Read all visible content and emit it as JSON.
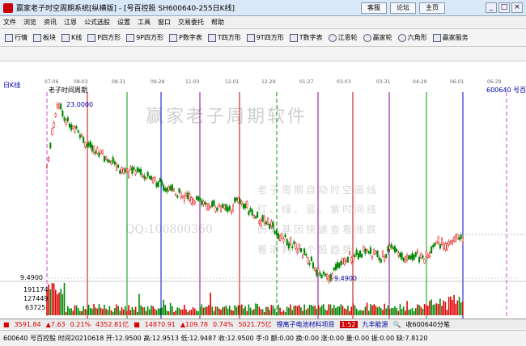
{
  "window": {
    "title": "赢家老子时空周期系统[纵横版] - [号百控股  SH600640-255日K线]",
    "buttons": [
      "客服",
      "论坛",
      "主页"
    ],
    "controls": [
      "_",
      "□",
      "×"
    ]
  },
  "menu": [
    "文件",
    "浏览",
    "资讯",
    "江恩",
    "公式选股",
    "设置",
    "工具",
    "窗口",
    "交易委托",
    "帮助"
  ],
  "toolbar": [
    {
      "icon": "grid-icon",
      "label": "行情"
    },
    {
      "icon": "board-icon",
      "label": "板块"
    },
    {
      "icon": "candlestick-icon",
      "label": "K线"
    },
    {
      "icon": "p-square-icon",
      "label": "P四方形"
    },
    {
      "icon": "nine-square-icon",
      "label": "9P四方形"
    },
    {
      "icon": "p-text-icon",
      "label": "P数字表"
    },
    {
      "icon": "t-square-icon",
      "label": "T四方形"
    },
    {
      "icon": "nine-t-square-icon",
      "label": "9T四方形"
    },
    {
      "icon": "t-text-icon",
      "label": "T数字表"
    },
    {
      "icon": "wheel-icon",
      "label": "江恩轮"
    },
    {
      "icon": "winner-wheel-icon",
      "label": "赢家轮"
    },
    {
      "icon": "hexagon-icon",
      "label": "六角形"
    },
    {
      "icon": "service-icon",
      "label": "赢家服务"
    }
  ],
  "drawing_tools_count": 44,
  "chart": {
    "period_label": "日K线",
    "cycle_label": "老子时间周期",
    "stock_label": "600640  号百控股",
    "watermark": "赢家老子周期软件",
    "qq": "QQ:100800360",
    "promo": [
      "老子周期自动时空画线",
      "红、绿、蓝、紫时间线",
      "历史基因快速查看涨跌",
      "看清判断个股趋势"
    ],
    "high_label": "23.0000",
    "low_label": "9.4900",
    "price_low_axis": "9.4900",
    "volume_axis": [
      "191174",
      "127449",
      "63725"
    ],
    "dates": [
      "07-06",
      "08-03",
      "08-31",
      "09-28",
      "11-03",
      "12-01",
      "12-29",
      "01-27",
      "03-03",
      "03-31",
      "04-29",
      "06-01",
      "06-29"
    ],
    "colors": {
      "up": "#e00000",
      "down": "#008800",
      "cycle_red": "#c00000",
      "cycle_green": "#009900",
      "cycle_blue": "#0000cc",
      "cycle_purple": "#880088",
      "cycle_pink": "#cc44cc"
    }
  },
  "status": {
    "sh": "3591.84",
    "sh_chg": "▲7.63",
    "sh_pct": "0.21%",
    "sh_amt": "4352.81亿",
    "sz": "14870.91",
    "sz_chg": "▲109.78",
    "sz_pct": "0.74%",
    "sz_amt": "5021.75亿",
    "news": "锂离子电池材料项目",
    "badge": "1:52",
    "news2": "九丰能源",
    "search": "收600640分笔"
  },
  "info": "600640 号百控股 时间20210618 开:12.9500 高:12.9513 低:12.9487 收:12.9500 手:0 额:0.00 换:0.00 涨:0.00 量:0.00 振:0.00 缺:7.8120"
}
